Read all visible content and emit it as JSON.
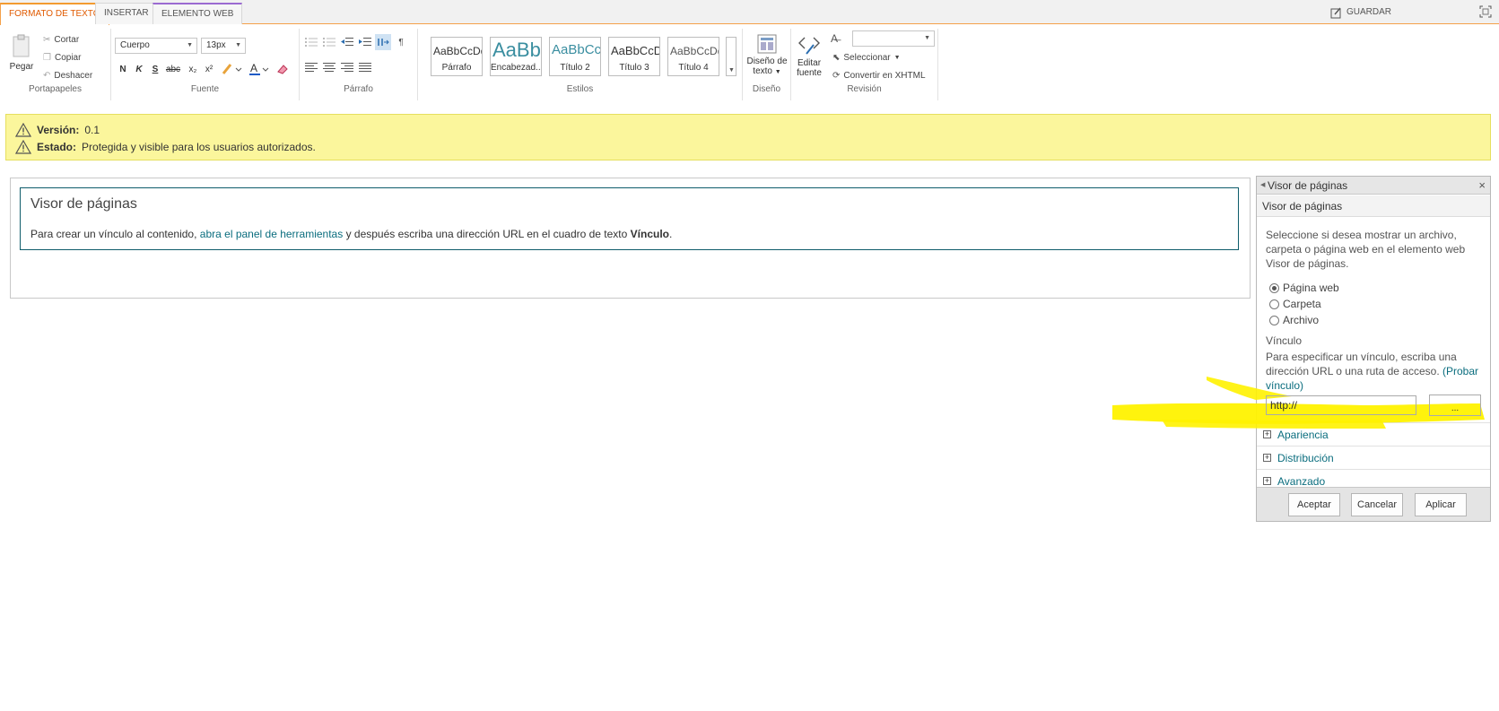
{
  "tabs": [
    {
      "label": "FORMATO DE TEXTO"
    },
    {
      "label": "INSERTAR"
    },
    {
      "label": "ELEMENTO WEB"
    }
  ],
  "save_label": "GUARDAR",
  "clipboard": {
    "paste": "Pegar",
    "cut": "Cortar",
    "copy": "Copiar",
    "undo": "Deshacer",
    "label": "Portapapeles"
  },
  "font": {
    "family_value": "Cuerpo",
    "size_value": "13px",
    "bold": "N",
    "italic": "K",
    "underline": "S",
    "strike": "abc",
    "sub": "x₂",
    "sup": "x²",
    "label": "Fuente"
  },
  "paragraph": {
    "label": "Párrafo"
  },
  "styles": {
    "items": [
      {
        "sample": "AaBbCcDdEe",
        "name": "Párrafo"
      },
      {
        "sample": "AaBb",
        "name": "Encabezad..."
      },
      {
        "sample": "AaBbCc",
        "name": "Título 2"
      },
      {
        "sample": "AaBbCcDd",
        "name": "Título 3"
      },
      {
        "sample": "AaBbCcDdE",
        "name": "Título 4"
      }
    ],
    "label": "Estilos"
  },
  "design": {
    "button_line1": "Diseño de",
    "button_line2": "texto",
    "label": "Diseño"
  },
  "review": {
    "edit_line1": "Editar",
    "edit_line2": "fuente",
    "select": "Seleccionar",
    "convert": "Convertir en XHTML",
    "label": "Revisión"
  },
  "status": {
    "version_label": "Versión:",
    "version_value": "0.1",
    "state_label": "Estado:",
    "state_value": "Protegida y visible para los usuarios autorizados."
  },
  "webpart": {
    "title": "Visor de páginas",
    "text_before": "Para crear un vínculo al contenido,",
    "link": "abra el panel de herramientas",
    "text_after": "y después escriba una dirección URL en el cuadro de texto",
    "bold_word": "Vínculo",
    "end": "."
  },
  "pane": {
    "header": "Visor de páginas",
    "close": "×",
    "subheader": "Visor de páginas",
    "description": "Seleccione si desea mostrar un archivo, carpeta o página web en el elemento web Visor de páginas.",
    "options": [
      {
        "label": "Página web",
        "selected": true
      },
      {
        "label": "Carpeta",
        "selected": false
      },
      {
        "label": "Archivo",
        "selected": false
      }
    ],
    "link_label": "Vínculo",
    "link_help": "Para especificar un vínculo, escriba una dirección URL o una ruta de acceso.",
    "test_link": "(Probar vínculo)",
    "url_value": "http://",
    "browse": "...",
    "sections": [
      {
        "label": "Apariencia"
      },
      {
        "label": "Distribución"
      },
      {
        "label": "Avanzado"
      }
    ],
    "ok": "Aceptar",
    "cancel": "Cancelar",
    "apply": "Aplicar"
  },
  "colors": {
    "accent_orange": "#f39b30",
    "link_teal": "#0a6d7e",
    "status_yellow": "#fbf69c",
    "highlight": "#ffff00"
  }
}
